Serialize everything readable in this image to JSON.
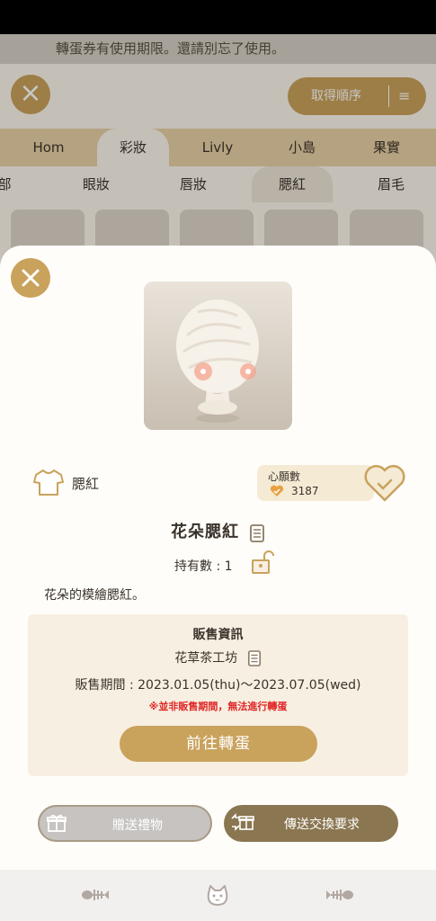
{
  "background": {
    "notice": "轉蛋券有使用期限。還請別忘了使用。",
    "sort_label": "取得順序",
    "category_tabs": [
      "Hom",
      "彩妝",
      "Livly",
      "小島",
      "果實"
    ],
    "sub_tabs": [
      "部",
      "眼妝",
      "唇妝",
      "腮紅",
      "眉毛"
    ]
  },
  "item": {
    "category": "腮紅",
    "name": "花朵腮紅",
    "owned": "持有數 : 1",
    "description": "花朵的模繪腮紅。"
  },
  "wish": {
    "label": "心願數",
    "count": "3187"
  },
  "sale": {
    "title": "販售資訊",
    "shop": "花草茶工坊",
    "period": "販售期間 : 2023.01.05(thu)〜2023.07.05(wed)",
    "warning": "※並非販售期間，無法進行轉蛋",
    "go_button": "前往轉蛋"
  },
  "actions": {
    "gift": "贈送禮物",
    "trade": "傳送交換要求"
  },
  "colors": {
    "accent": "#c9a25c",
    "warning": "#e02424",
    "trade_button": "#8a7651",
    "sale_box": "#f7efe1"
  }
}
